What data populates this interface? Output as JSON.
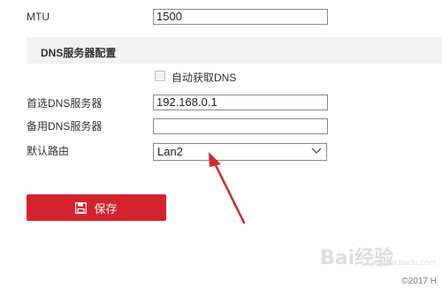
{
  "mtu": {
    "label": "MTU",
    "value": "1500"
  },
  "dns_section": {
    "title": "DNS服务器配置",
    "auto_dns_label": "自动获取DNS",
    "auto_dns_checked": false
  },
  "preferred_dns": {
    "label": "首选DNS服务器",
    "value": "192.168.0.1"
  },
  "alternate_dns": {
    "label": "备用DNS服务器",
    "value": ""
  },
  "default_route": {
    "label": "默认路由",
    "value": "Lan2"
  },
  "save_button": {
    "label": "保存",
    "icon": "floppy-disk-icon",
    "color": "#d6222d"
  },
  "annotation": {
    "color": "#d6262d",
    "icon": "red-arrow-icon"
  },
  "watermark": {
    "text": "Bai经验",
    "sub": "jingyan.baidu.com"
  },
  "footer": {
    "copyright": "©2017 H"
  }
}
